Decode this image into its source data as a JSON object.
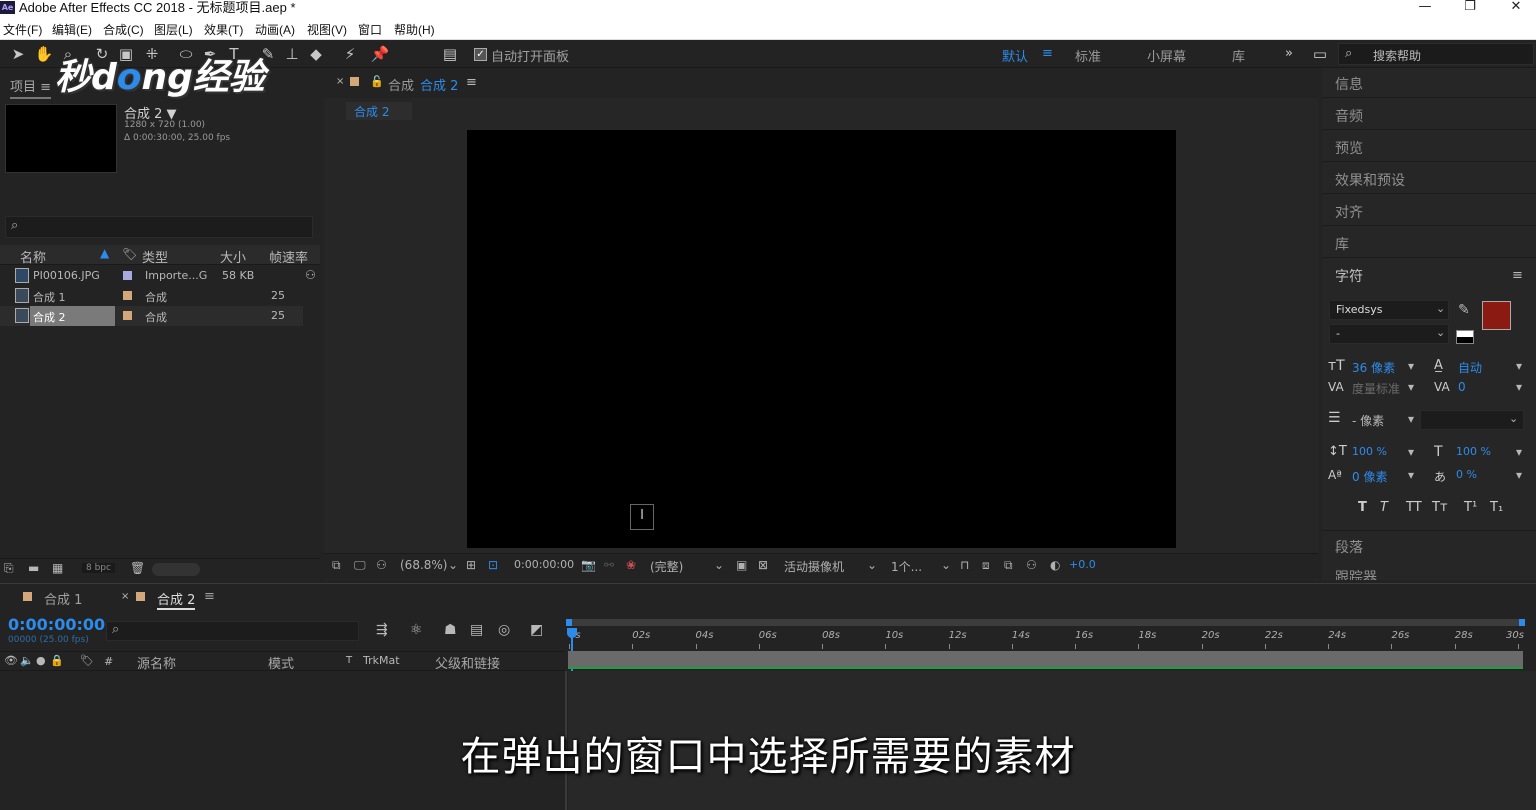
{
  "titlebar": {
    "app_icon": "Ae",
    "title": "Adobe After Effects CC 2018 - 无标题项目.aep *"
  },
  "menu": [
    "文件(F)",
    "编辑(E)",
    "合成(C)",
    "图层(L)",
    "效果(T)",
    "动画(A)",
    "视图(V)",
    "窗口",
    "帮助(H)"
  ],
  "toolbar": {
    "auto_open_label": "自动打开面板",
    "workspaces": [
      "默认",
      "标准",
      "小屏幕",
      "库"
    ],
    "active_workspace_icon": "≡",
    "more": "»",
    "search_help": "搜索帮助"
  },
  "watermark": {
    "part1": "秒d",
    "part2": "o",
    "part3": "ng经验"
  },
  "project": {
    "tab": "项目",
    "tab_menu": "≡",
    "comp_name": "合成 2 ▼",
    "comp_res": "1280 x 720 (1.00)",
    "comp_dur": "Δ 0:00:30:00, 25.00 fps",
    "search_icon": "⌕",
    "columns": {
      "name": "名称",
      "type": "类型",
      "size": "大小",
      "fps": "帧速率"
    },
    "rows": [
      {
        "name": "PI00106.JPG",
        "type": "Importe...G",
        "size": "58 KB",
        "fps": "",
        "color": "#a9a9e0"
      },
      {
        "name": "合成 1",
        "type": "合成",
        "size": "",
        "fps": "25",
        "color": "#d4a77a"
      },
      {
        "name": "合成 2",
        "type": "合成",
        "size": "",
        "fps": "25",
        "color": "#d4a77a"
      }
    ],
    "bpc": "8 bpc"
  },
  "viewer": {
    "tab_prefix": "合成",
    "tab_active": "合成 2",
    "tab_menu": "≡",
    "breadcrumb": "合成 2",
    "zoom": "(68.8%)",
    "timecode": "0:00:00:00",
    "resolution": "(完整)",
    "camera": "活动摄像机",
    "views": "1个...",
    "exposure": "+0.0"
  },
  "right_panel": {
    "items": [
      "信息",
      "音频",
      "预览",
      "效果和预设",
      "对齐",
      "库"
    ],
    "character": {
      "title": "字符",
      "menu": "≡",
      "font": "Fixedsys",
      "style": "-",
      "size": "36 像素",
      "leading": "自动",
      "kerning": "度量标准",
      "tracking": "0",
      "stroke": "- 像素",
      "vscale": "100 %",
      "hscale": "100 %",
      "baseline": "0 像素",
      "tsume": "0 %",
      "styles": [
        "T",
        "T",
        "TT",
        "Tт",
        "T¹",
        "T₁"
      ],
      "fill_color": "#8b1a12"
    },
    "paragraph": "段落",
    "tracker": "跟踪器"
  },
  "timeline": {
    "tabs": [
      "合成 1",
      "合成 2"
    ],
    "tab_menu": "≡",
    "timecode": "0:00:00:00",
    "frame_info": "00000 (25.00 fps)",
    "ruler": [
      "0s",
      "02s",
      "04s",
      "06s",
      "08s",
      "10s",
      "12s",
      "14s",
      "16s",
      "18s",
      "20s",
      "22s",
      "24s",
      "26s",
      "28s",
      "30s"
    ],
    "columns": {
      "source": "源名称",
      "mode": "模式",
      "t": "T",
      "trkmat": "TrkMat",
      "parent": "父级和链接"
    }
  },
  "subtitle": "在弹出的窗口中选择所需要的素材"
}
